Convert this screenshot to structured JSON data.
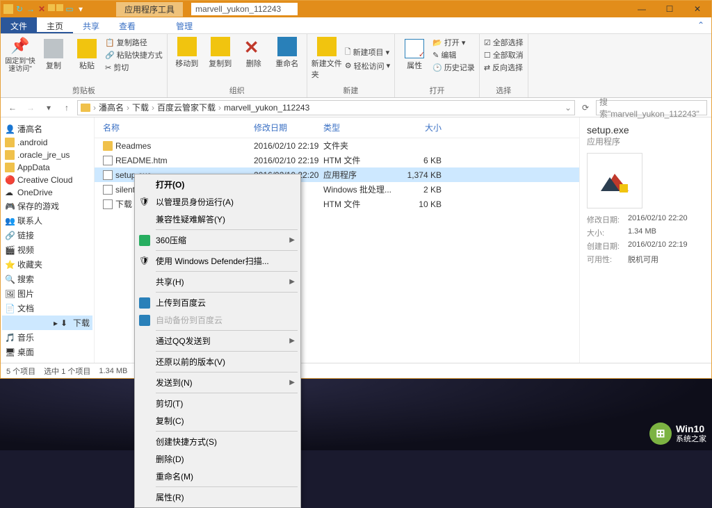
{
  "titlebar": {
    "tools_label": "应用程序工具",
    "title": "marvell_yukon_112243"
  },
  "tabs": {
    "file": "文件",
    "home": "主页",
    "share": "共享",
    "view": "查看",
    "manage": "管理"
  },
  "ribbon": {
    "pin": "固定到\"快速访问\"",
    "copy": "复制",
    "paste": "粘贴",
    "copy_path": "复制路径",
    "shortcut": "粘贴快捷方式",
    "cut": "剪切",
    "clipboard": "剪贴板",
    "move_to": "移动到",
    "copy_to": "复制到",
    "delete": "删除",
    "rename": "重命名",
    "organize": "组织",
    "new_folder": "新建文件夹",
    "new_item": "新建项目",
    "easy_access": "轻松访问",
    "new": "新建",
    "properties": "属性",
    "open": "打开",
    "edit": "编辑",
    "history": "历史记录",
    "open_grp": "打开",
    "select_all": "全部选择",
    "select_none": "全部取消",
    "invert": "反向选择",
    "select": "选择"
  },
  "breadcrumb": [
    "潘高名",
    "下载",
    "百度云管家下载",
    "marvell_yukon_112243"
  ],
  "search_placeholder": "搜索\"marvell_yukon_112243\"",
  "tree": [
    {
      "label": "潘高名",
      "type": "user"
    },
    {
      "label": ".android",
      "type": "folder"
    },
    {
      "label": ".oracle_jre_us",
      "type": "folder"
    },
    {
      "label": "AppData",
      "type": "folder"
    },
    {
      "label": "Creative Cloud",
      "type": "cc"
    },
    {
      "label": "OneDrive",
      "type": "od"
    },
    {
      "label": "保存的游戏",
      "type": "games"
    },
    {
      "label": "联系人",
      "type": "contacts"
    },
    {
      "label": "链接",
      "type": "links"
    },
    {
      "label": "视频",
      "type": "video"
    },
    {
      "label": "收藏夹",
      "type": "fav"
    },
    {
      "label": "搜索",
      "type": "search"
    },
    {
      "label": "图片",
      "type": "pic"
    },
    {
      "label": "文档",
      "type": "doc"
    },
    {
      "label": "下载",
      "type": "dl",
      "selected": true
    },
    {
      "label": "音乐",
      "type": "music"
    },
    {
      "label": "桌面",
      "type": "desktop"
    }
  ],
  "columns": {
    "name": "名称",
    "date": "修改日期",
    "type": "类型",
    "size": "大小"
  },
  "rows": [
    {
      "name": "Readmes",
      "date": "2016/02/10 22:19",
      "type": "文件夹",
      "size": ""
    },
    {
      "name": "README.htm",
      "date": "2016/02/10 22:19",
      "type": "HTM 文件",
      "size": "6 KB"
    },
    {
      "name": "setup.exe",
      "date": "2016/02/10 22:20",
      "type": "应用程序",
      "size": "1,374 KB",
      "selected": true
    },
    {
      "name": "silent",
      "date": "",
      "date_end": "22:19",
      "type": "Windows 批处理...",
      "size": "2 KB"
    },
    {
      "name": "下载",
      "date": "",
      "date_end": "22:19",
      "type": "HTM 文件",
      "size": "10 KB"
    }
  ],
  "context": [
    {
      "label": "打开(O)",
      "bold": true
    },
    {
      "label": "以管理员身份运行(A)",
      "icon": "shield"
    },
    {
      "label": "兼容性疑难解答(Y)"
    },
    {
      "sep": true
    },
    {
      "label": "360压缩",
      "icon": "zip",
      "sub": true
    },
    {
      "sep": true
    },
    {
      "label": "使用 Windows Defender扫描...",
      "icon": "def"
    },
    {
      "sep": true
    },
    {
      "label": "共享(H)",
      "sub": true
    },
    {
      "sep": true
    },
    {
      "label": "上传到百度云",
      "icon": "baidu"
    },
    {
      "label": "自动备份到百度云",
      "icon": "baidu",
      "disabled": true
    },
    {
      "sep": true
    },
    {
      "label": "通过QQ发送到",
      "sub": true
    },
    {
      "sep": true
    },
    {
      "label": "还原以前的版本(V)"
    },
    {
      "sep": true
    },
    {
      "label": "发送到(N)",
      "sub": true
    },
    {
      "sep": true
    },
    {
      "label": "剪切(T)"
    },
    {
      "label": "复制(C)"
    },
    {
      "sep": true
    },
    {
      "label": "创建快捷方式(S)"
    },
    {
      "label": "删除(D)"
    },
    {
      "label": "重命名(M)"
    },
    {
      "sep": true
    },
    {
      "label": "属性(R)"
    }
  ],
  "details": {
    "name": "setup.exe",
    "type": "应用程序",
    "mod_k": "修改日期:",
    "mod_v": "2016/02/10 22:20",
    "size_k": "大小:",
    "size_v": "1.34 MB",
    "create_k": "创建日期:",
    "create_v": "2016/02/10 22:19",
    "avail_k": "可用性:",
    "avail_v": "脱机可用"
  },
  "status": {
    "items": "5 个项目",
    "selected": "选中 1 个项目",
    "size": "1.34 MB"
  },
  "watermark": {
    "brand": "Win10",
    "sub": "系统之家"
  }
}
